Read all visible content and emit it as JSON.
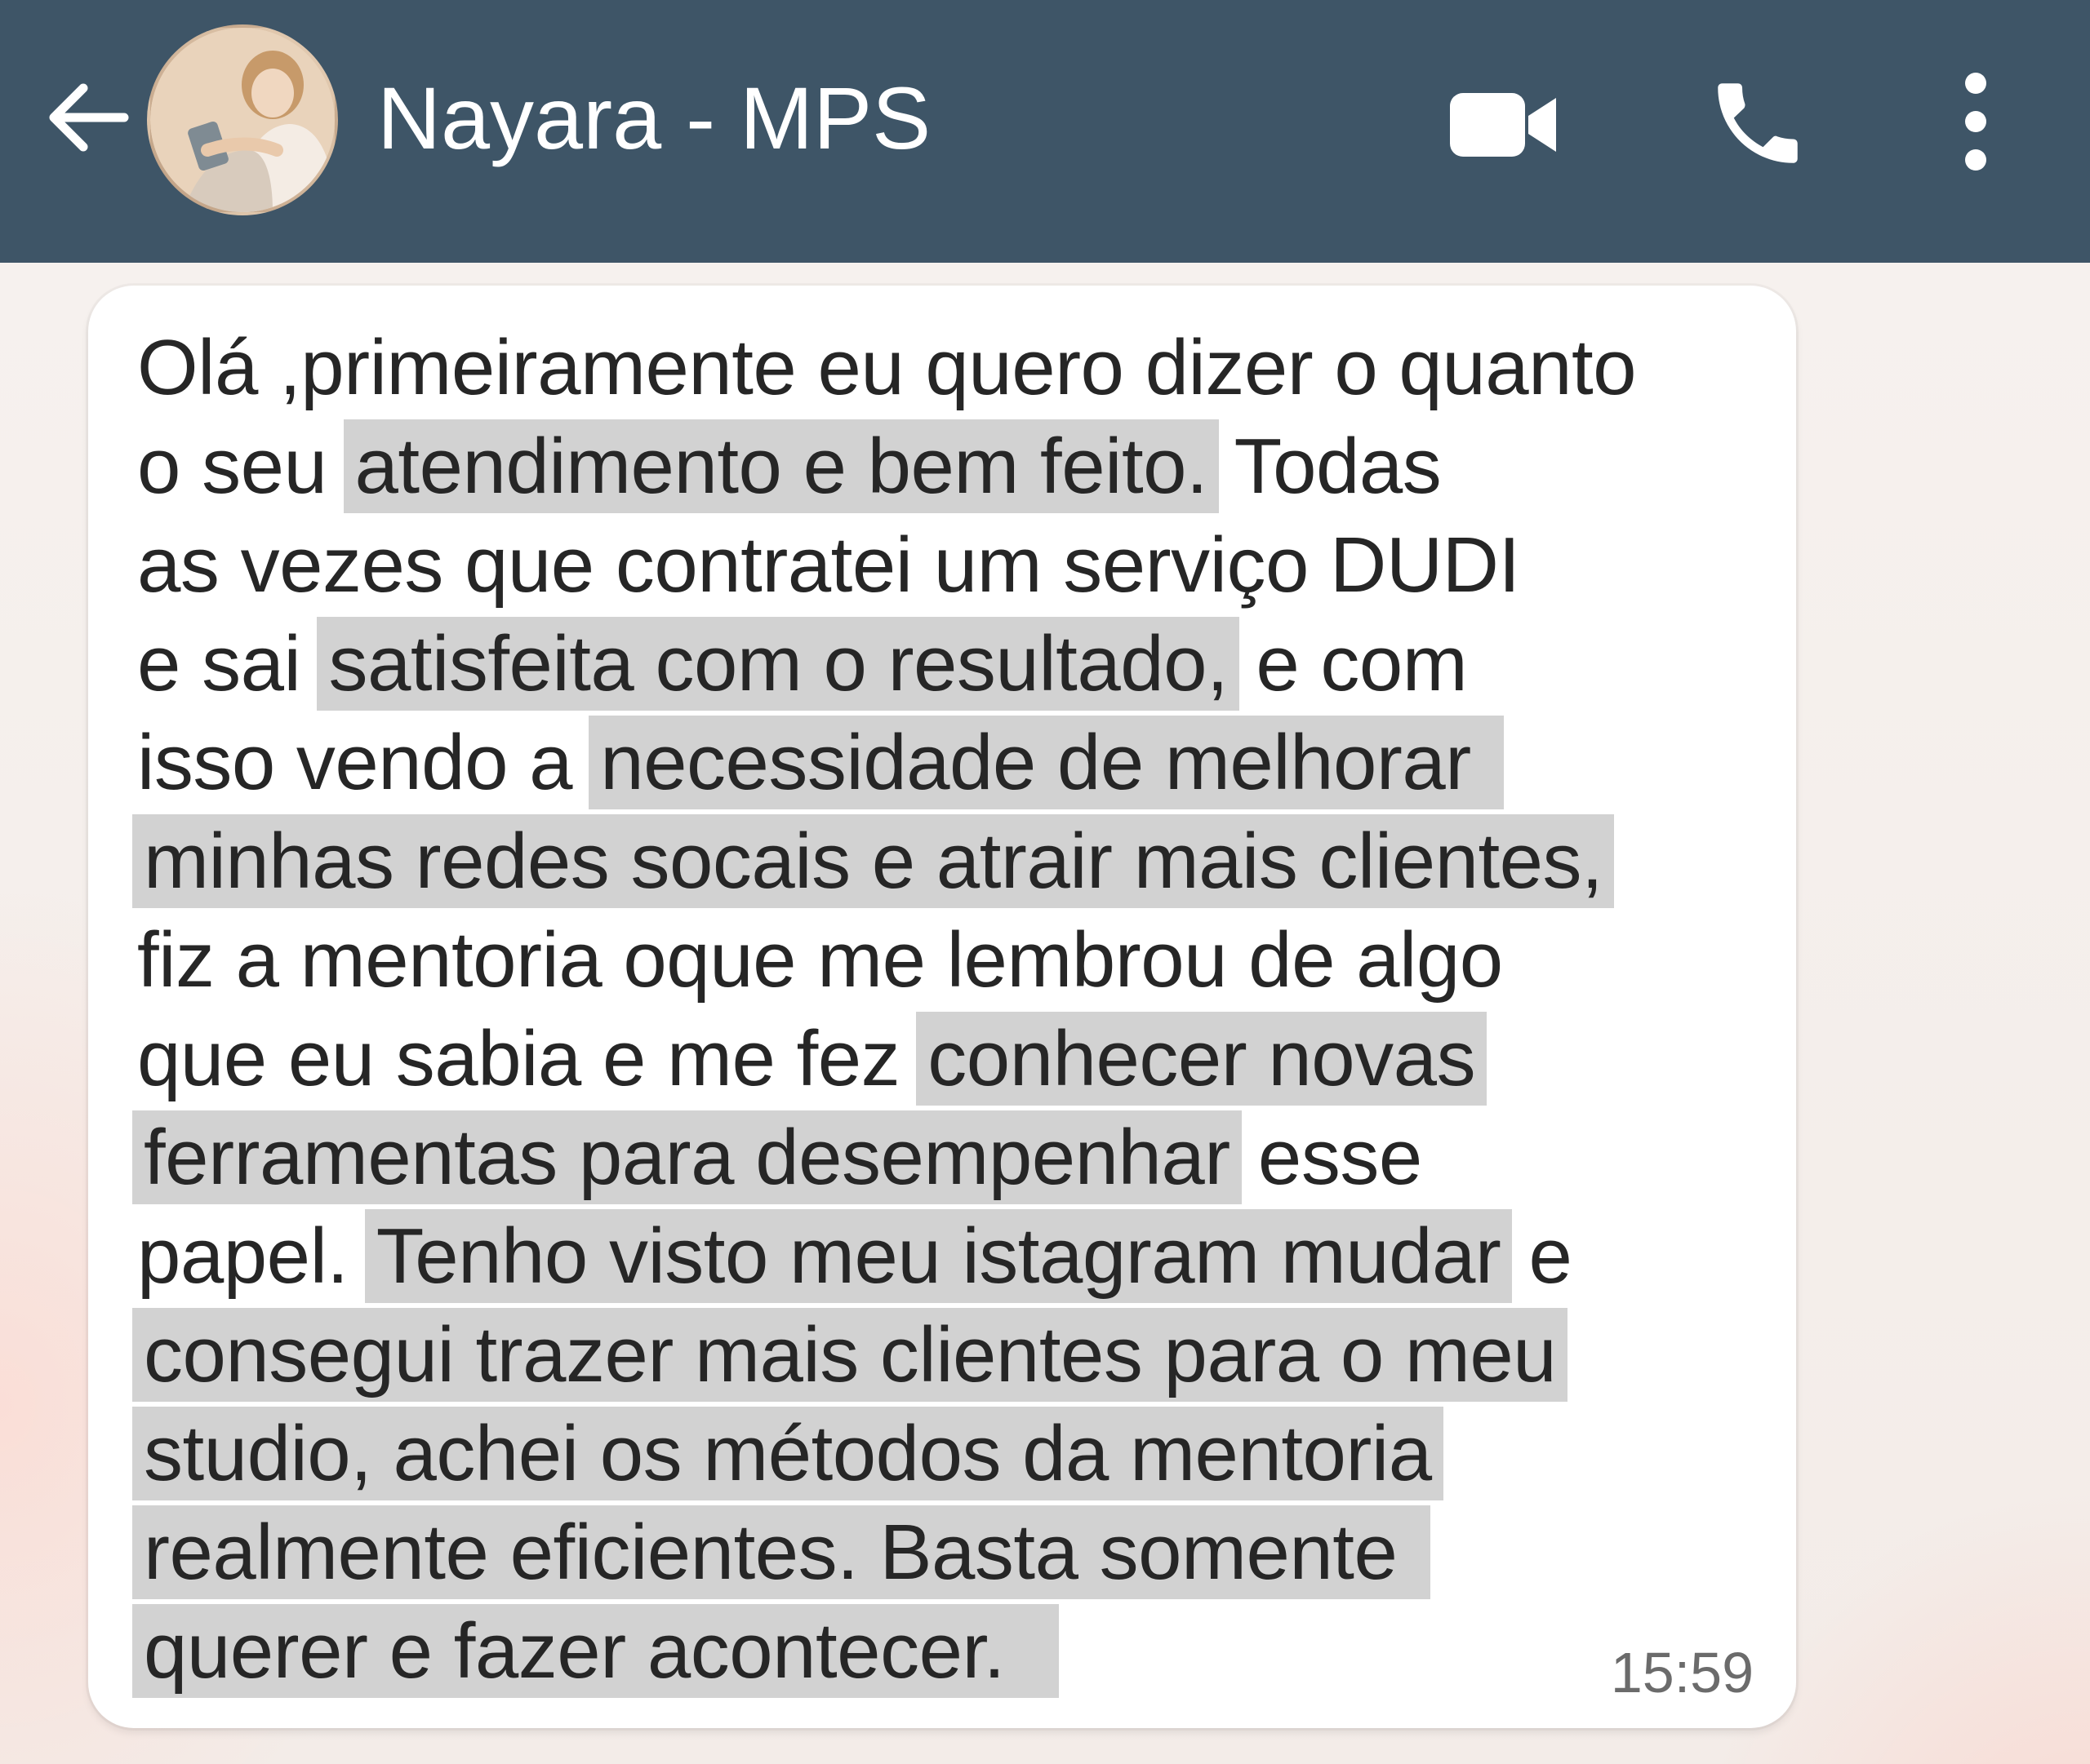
{
  "header": {
    "contact_name": "Nayara - MPS",
    "bg_color": "#3e5567"
  },
  "icons": {
    "back": "arrow-left-icon",
    "avatar": "contact-avatar",
    "video": "video-camera-icon",
    "call": "phone-icon",
    "more": "more-vert-icon"
  },
  "message": {
    "lines": [
      [
        "Olá ,primeiramente eu quero dizer o quanto"
      ],
      [
        "o seu ",
        "atendimento e bem feito.",
        " Todas"
      ],
      [
        "as vezes que contratei um serviço DUDI"
      ],
      [
        "e sai ",
        "satisfeita com o resultado,",
        " e com"
      ],
      [
        "isso vendo a ",
        "necessidade de melhorar "
      ],
      [
        "",
        "minhas redes socais e atrair mais clientes,"
      ],
      [
        "fiz a mentoria oque me lembrou de algo"
      ],
      [
        "que eu sabia e me fez ",
        "conhecer novas"
      ],
      [
        "",
        "ferramentas para desempenhar",
        " esse"
      ],
      [
        "papel. ",
        "Tenho visto meu istagram mudar",
        " e"
      ],
      [
        "",
        "consegui trazer mais clientes para o meu"
      ],
      [
        "",
        "studio, achei os métodos da mentoria"
      ],
      [
        "",
        "realmente eficientes. Basta somente "
      ],
      [
        "",
        "querer e fazer acontecer.  "
      ]
    ],
    "time": "15:59",
    "highlight_color": "#d2d2d2"
  }
}
